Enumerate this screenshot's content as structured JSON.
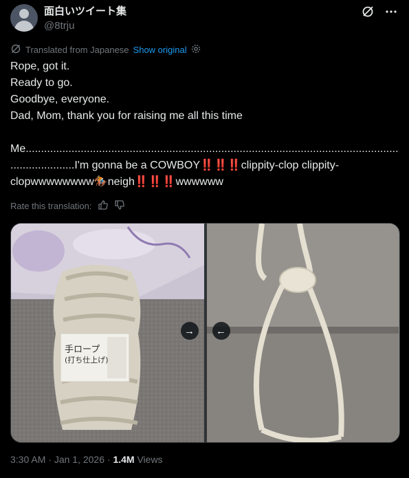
{
  "author": {
    "display_name": "面白いツイート集",
    "handle": "@8trju",
    "avatar": "default-avatar"
  },
  "header_icons": [
    "grok-icon",
    "more-icon"
  ],
  "translation": {
    "label": "Translated from Japanese",
    "show_original": "Show original",
    "icon": "translate-icon",
    "settings_icon": "gear-icon"
  },
  "tweet": {
    "lines": [
      "Rope, got it.",
      "Ready to go.",
      "Goodbye, everyone.",
      "Dad, Mom, thank you for raising me all this time",
      "",
      "Me................................................................................................................................",
      ".....................I'm gonna be a COWBOY‼️‼️‼️clippity-clop clippity-",
      "clopwwwwwwww🏇neigh‼️‼️‼️wwwwww"
    ]
  },
  "rate": {
    "label": "Rate this translation:",
    "thumbs_up_icon": "thumbs-up-icon",
    "thumbs_down_icon": "thumbs-down-icon"
  },
  "media": {
    "next_button_icon": "arrow-right-icon",
    "prev_button_icon": "arrow-left-icon",
    "next_glyph": "→",
    "prev_glyph": "←",
    "left_photo_label": "手ロープ",
    "left_photo_sublabel": "(打ち仕上げ)"
  },
  "meta": {
    "time": "3:30 AM",
    "separator": "·",
    "date": "Jan 1, 2026",
    "views_count": "1.4M",
    "views_label": "Views"
  }
}
